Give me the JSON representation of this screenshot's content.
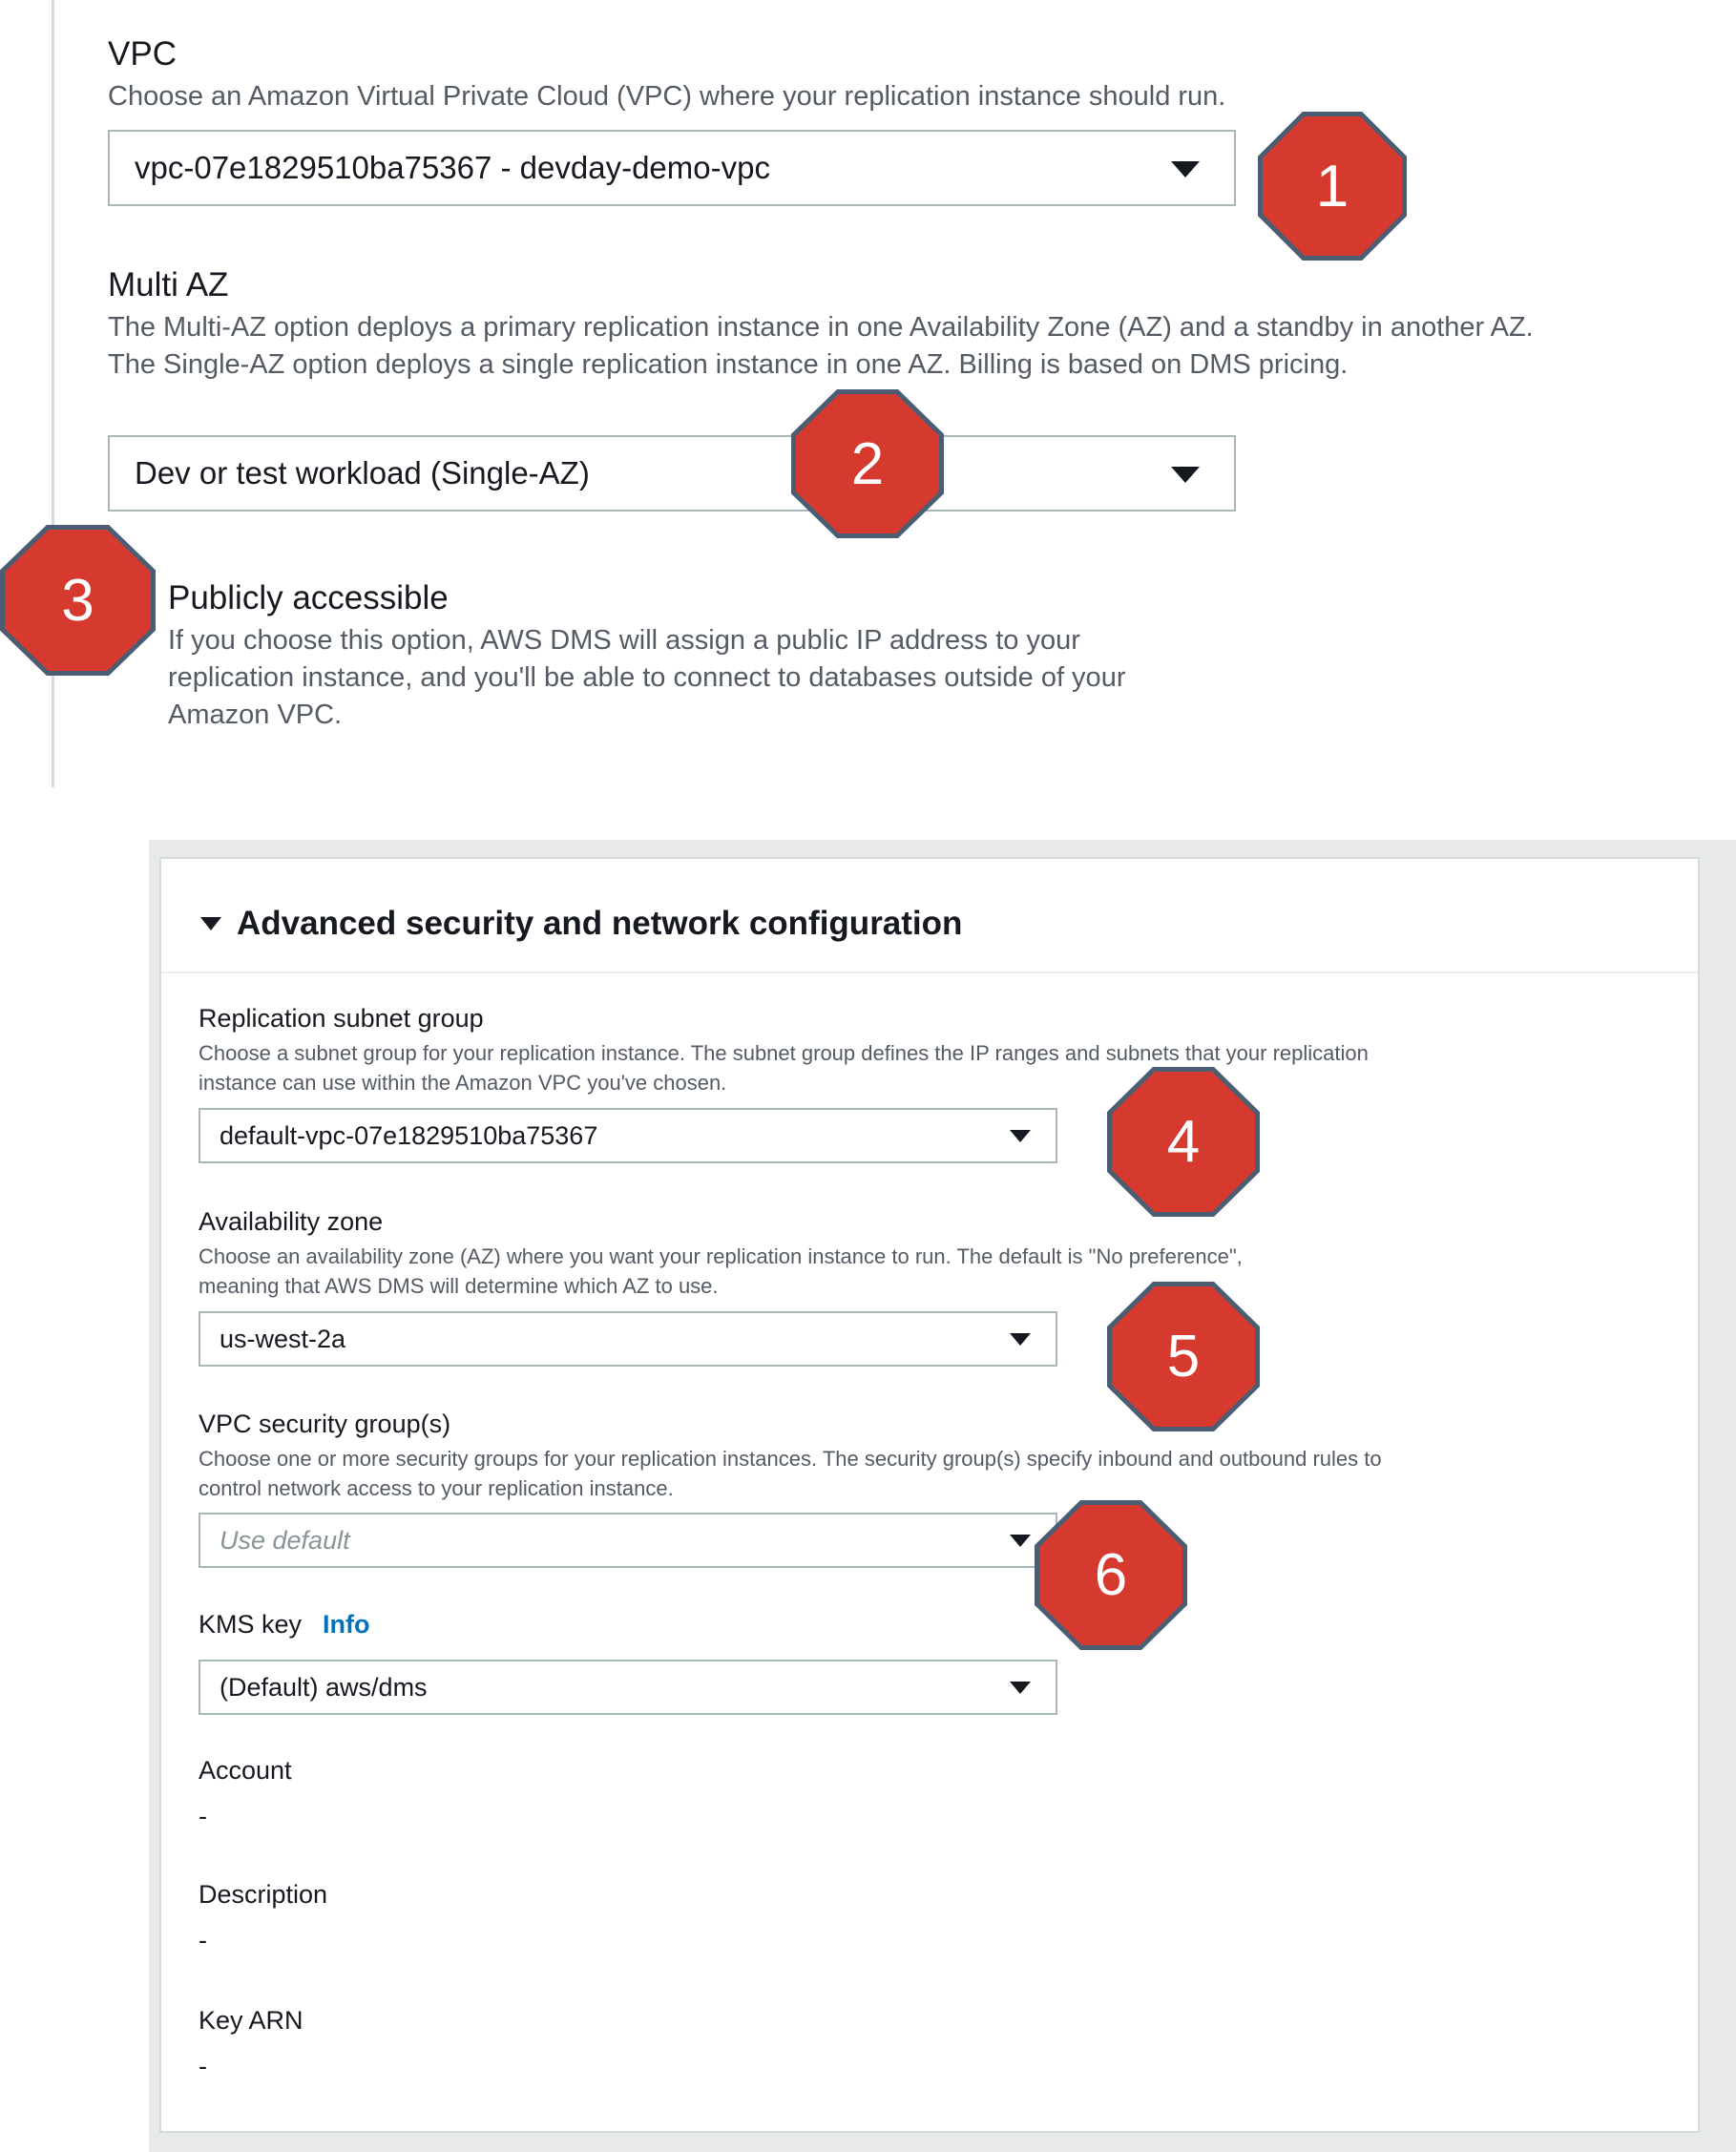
{
  "vpc": {
    "label": "VPC",
    "description": "Choose an Amazon Virtual Private Cloud (VPC) where your replication instance should run.",
    "selected": "vpc-07e1829510ba75367 - devday-demo-vpc"
  },
  "multi_az": {
    "label": "Multi AZ",
    "description": "The Multi-AZ option deploys a primary replication instance in one Availability Zone (AZ) and a standby in another AZ. The Single-AZ option deploys a single replication instance in one AZ. Billing is based on DMS pricing.",
    "selected": "Dev or test workload (Single-AZ)"
  },
  "publicly_accessible": {
    "label": "Publicly accessible",
    "description": "If you choose this option, AWS DMS will assign a public IP address to your replication instance, and you'll be able to connect to databases outside of your Amazon VPC."
  },
  "advanced": {
    "title": "Advanced security and network configuration",
    "subnet_group": {
      "label": "Replication subnet group",
      "description": "Choose a subnet group for your replication instance. The subnet group defines the IP ranges and subnets that your replication instance can use within the Amazon VPC you've chosen.",
      "selected": "default-vpc-07e1829510ba75367"
    },
    "availability_zone": {
      "label": "Availability zone",
      "description": "Choose an availability zone (AZ) where you want your replication instance to run. The default is \"No preference\", meaning that AWS DMS will determine which AZ to use.",
      "selected": "us-west-2a"
    },
    "security_groups": {
      "label": "VPC security group(s)",
      "description": "Choose one or more security groups for your replication instances. The security group(s) specify inbound and outbound rules to control network access to your replication instance.",
      "placeholder": "Use default"
    },
    "kms_key": {
      "label": "KMS key",
      "info": "Info",
      "selected": "(Default) aws/dms"
    },
    "account": {
      "label": "Account",
      "value": "-"
    },
    "description_field": {
      "label": "Description",
      "value": "-"
    },
    "key_arn": {
      "label": "Key ARN",
      "value": "-"
    }
  },
  "callouts": [
    "1",
    "2",
    "3",
    "4",
    "5",
    "6"
  ],
  "colors": {
    "callout_fill": "#d63a2f",
    "callout_border": "#4b5d73",
    "link": "#0073bb",
    "panel_background": "#e7e9ea"
  }
}
